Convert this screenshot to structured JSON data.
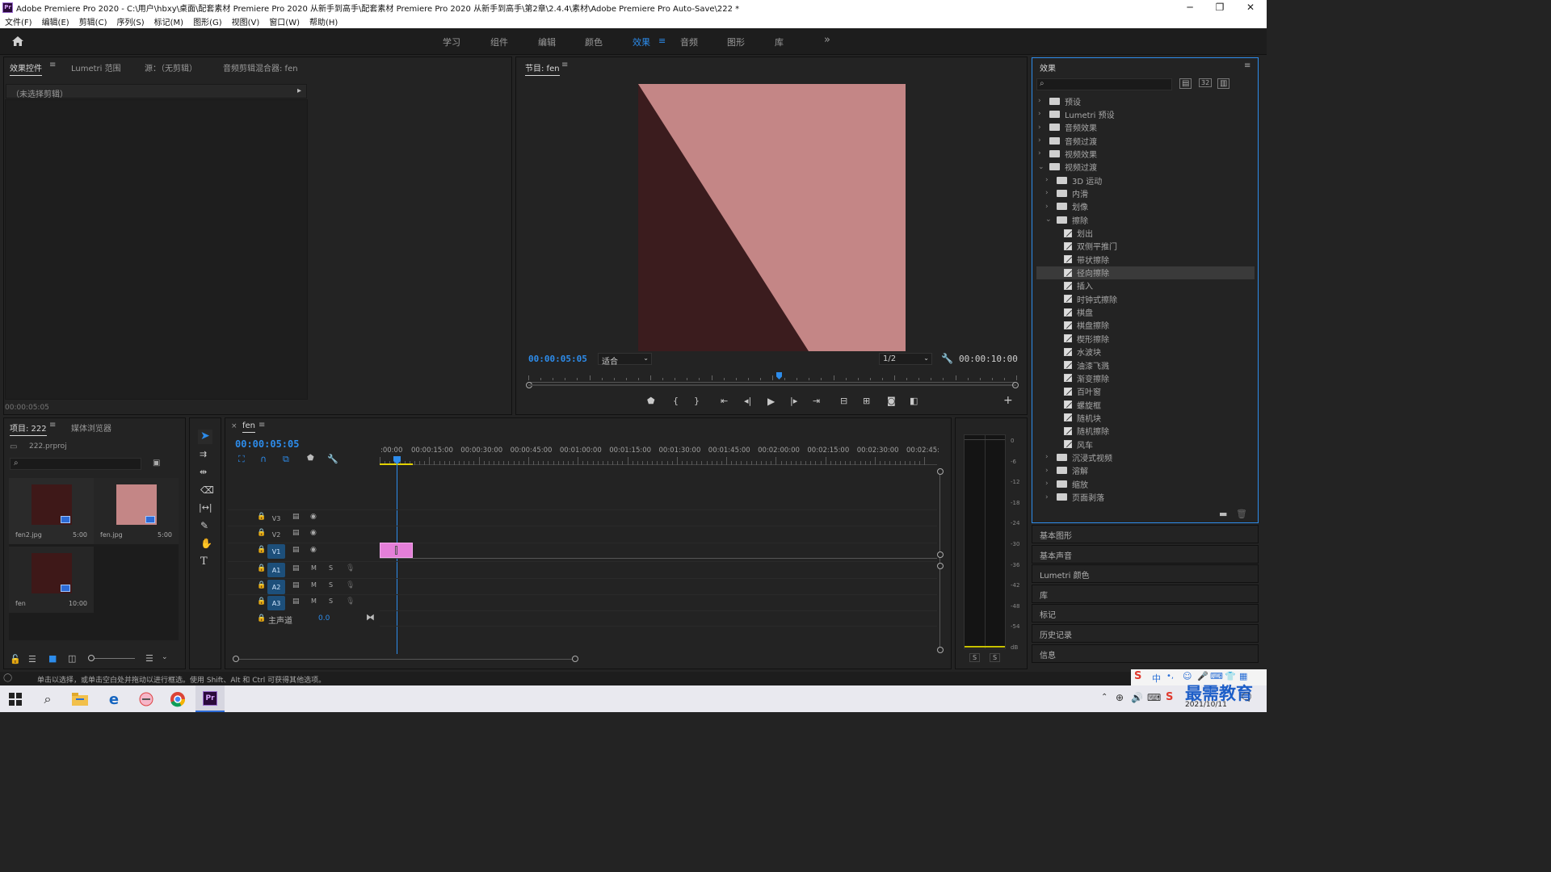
{
  "window": {
    "title": "Adobe Premiere Pro 2020 - C:\\用户\\hbxy\\桌面\\配套素材 Premiere Pro 2020 从新手到高手\\配套素材 Premiere Pro 2020 从新手到高手\\第2章\\2.4.4\\素材\\Adobe Premiere Pro Auto-Save\\222 *",
    "app_icon": "Pr"
  },
  "menu": [
    "文件(F)",
    "编辑(E)",
    "剪辑(C)",
    "序列(S)",
    "标记(M)",
    "图形(G)",
    "视图(V)",
    "窗口(W)",
    "帮助(H)"
  ],
  "workspaces": {
    "items": [
      "学习",
      "组件",
      "编辑",
      "颜色",
      "效果",
      "音频",
      "图形",
      "库"
    ],
    "active": "效果",
    "more": "»"
  },
  "source_panel": {
    "tabs": [
      "效果控件",
      "Lumetri 范围",
      "源：（无剪辑）",
      "音频剪辑混合器: fen"
    ],
    "no_clip": "（未选择剪辑）",
    "timecode": "00:00:05:05"
  },
  "program": {
    "title": "节目: fen",
    "timecode": "00:00:05:05",
    "fit": "适合",
    "resolution": "1/2",
    "duration": "00:00:10:00",
    "colors": {
      "frame_light": "#c48686",
      "frame_dark": "#3b1c1e"
    }
  },
  "project": {
    "tabs": [
      "项目: 222",
      "媒体浏览器"
    ],
    "file": "222.prproj",
    "items": [
      {
        "name": "fen2.jpg",
        "duration": "5:00",
        "thumb": "#3e1818"
      },
      {
        "name": "fen.jpg",
        "duration": "5:00",
        "thumb": "#c48686"
      },
      {
        "name": "fen",
        "duration": "10:00",
        "thumb": "#3e1818"
      }
    ]
  },
  "timeline": {
    "tab": "fen",
    "timecode": "00:00:05:05",
    "ruler": [
      ":00:00",
      "00:00:15:00",
      "00:00:30:00",
      "00:00:45:00",
      "00:01:00:00",
      "00:01:15:00",
      "00:01:30:00",
      "00:01:45:00",
      "00:02:00:00",
      "00:02:15:00",
      "00:02:30:00",
      "00:02:45:"
    ],
    "video_tracks": [
      "V3",
      "V2",
      "V1"
    ],
    "audio_tracks": [
      "A1",
      "A2",
      "A3"
    ],
    "master": "主声道",
    "master_value": "0.0",
    "m_label": "M",
    "s_label": "S",
    "clip_color": "#e57fd9"
  },
  "meter": {
    "ticks": [
      "0",
      "-6",
      "-12",
      "-18",
      "-24",
      "-30",
      "-36",
      "-42",
      "-48",
      "-54",
      "dB"
    ],
    "solo": [
      "S",
      "S"
    ]
  },
  "effects": {
    "title": "效果",
    "tree": [
      {
        "label": "预设",
        "depth": 0,
        "kind": "folder",
        "open": false
      },
      {
        "label": "Lumetri 预设",
        "depth": 0,
        "kind": "folder",
        "open": false
      },
      {
        "label": "音频效果",
        "depth": 0,
        "kind": "folder",
        "open": false
      },
      {
        "label": "音频过渡",
        "depth": 0,
        "kind": "folder",
        "open": false
      },
      {
        "label": "视频效果",
        "depth": 0,
        "kind": "folder",
        "open": false
      },
      {
        "label": "视频过渡",
        "depth": 0,
        "kind": "folder",
        "open": true
      },
      {
        "label": "3D 运动",
        "depth": 1,
        "kind": "folder",
        "open": false
      },
      {
        "label": "内滑",
        "depth": 1,
        "kind": "folder",
        "open": false
      },
      {
        "label": "划像",
        "depth": 1,
        "kind": "folder",
        "open": false
      },
      {
        "label": "擦除",
        "depth": 1,
        "kind": "folder",
        "open": true
      },
      {
        "label": "划出",
        "depth": 2,
        "kind": "fx"
      },
      {
        "label": "双侧平推门",
        "depth": 2,
        "kind": "fx"
      },
      {
        "label": "带状擦除",
        "depth": 2,
        "kind": "fx"
      },
      {
        "label": "径向擦除",
        "depth": 2,
        "kind": "fx",
        "selected": true
      },
      {
        "label": "插入",
        "depth": 2,
        "kind": "fx"
      },
      {
        "label": "时钟式擦除",
        "depth": 2,
        "kind": "fx"
      },
      {
        "label": "棋盘",
        "depth": 2,
        "kind": "fx"
      },
      {
        "label": "棋盘擦除",
        "depth": 2,
        "kind": "fx"
      },
      {
        "label": "楔形擦除",
        "depth": 2,
        "kind": "fx"
      },
      {
        "label": "水波块",
        "depth": 2,
        "kind": "fx"
      },
      {
        "label": "油漆飞溅",
        "depth": 2,
        "kind": "fx"
      },
      {
        "label": "渐变擦除",
        "depth": 2,
        "kind": "fx"
      },
      {
        "label": "百叶窗",
        "depth": 2,
        "kind": "fx"
      },
      {
        "label": "螺旋框",
        "depth": 2,
        "kind": "fx"
      },
      {
        "label": "随机块",
        "depth": 2,
        "kind": "fx"
      },
      {
        "label": "随机擦除",
        "depth": 2,
        "kind": "fx"
      },
      {
        "label": "风车",
        "depth": 2,
        "kind": "fx"
      },
      {
        "label": "沉浸式视频",
        "depth": 1,
        "kind": "folder",
        "open": false
      },
      {
        "label": "溶解",
        "depth": 1,
        "kind": "folder",
        "open": false
      },
      {
        "label": "缩放",
        "depth": 1,
        "kind": "folder",
        "open": false
      },
      {
        "label": "页面剥落",
        "depth": 1,
        "kind": "folder",
        "open": false
      }
    ]
  },
  "side_panels": [
    "基本图形",
    "基本声音",
    "Lumetri 颜色",
    "库",
    "标记",
    "历史记录",
    "信息"
  ],
  "status": "单击以选择，或单击空白处并拖动以进行框选。使用 Shift、Alt 和 Ctrl 可获得其他选项。",
  "taskbar": {
    "date": "2021/10/11",
    "ime": "中",
    "watermark": "最需教育"
  }
}
